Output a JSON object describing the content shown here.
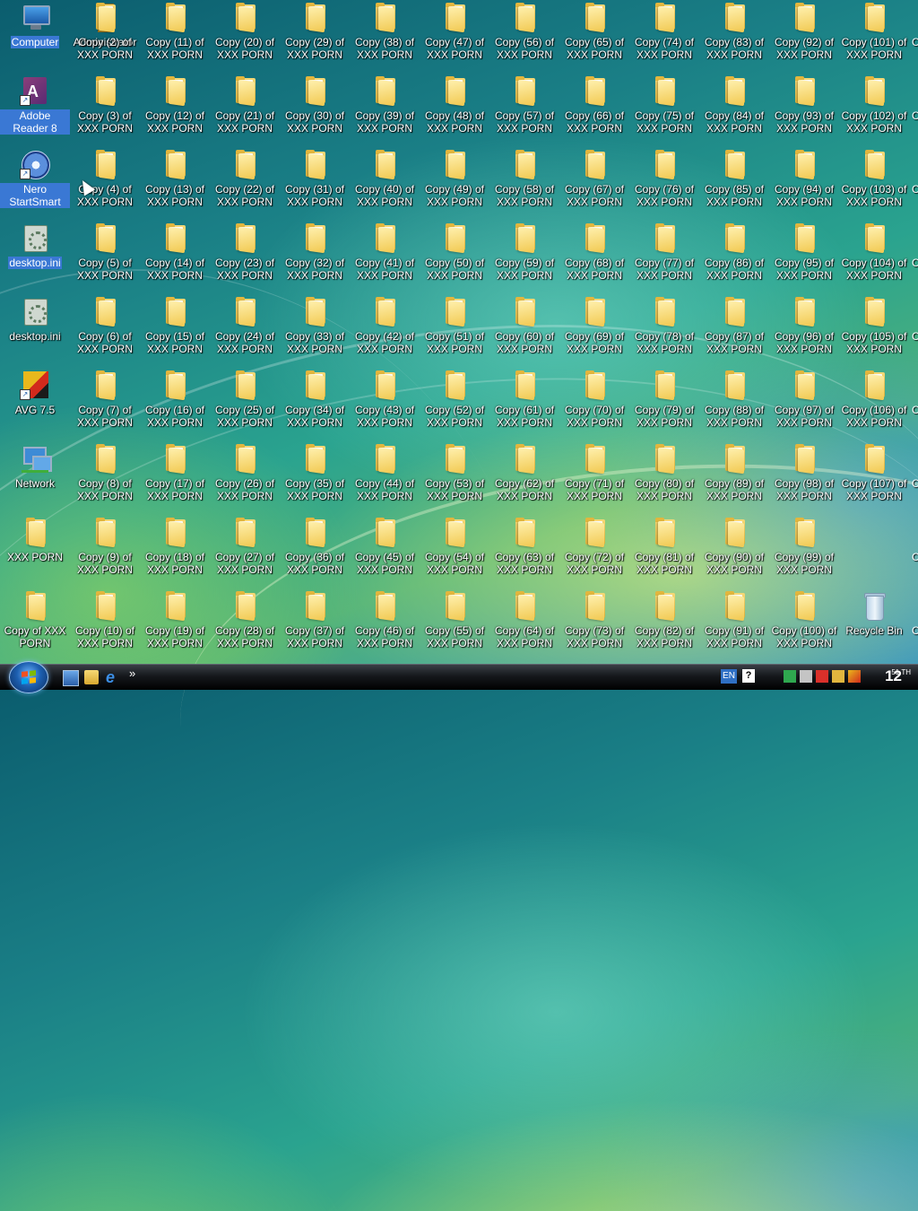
{
  "desktop": {
    "icons": [
      {
        "label": "Computer",
        "type": "computer",
        "selected": true
      },
      {
        "label": "Adobe Reader 8",
        "type": "pdf",
        "selected": true
      },
      {
        "label": "Nero StartSmart",
        "type": "nero",
        "selected": true
      },
      {
        "label": "desktop.ini",
        "type": "ini",
        "selected": true
      },
      {
        "label": "desktop.ini",
        "type": "ini",
        "selected": false
      },
      {
        "label": "AVG 7.5",
        "type": "avg",
        "selected": false
      },
      {
        "label": "Network",
        "type": "network",
        "selected": false
      },
      {
        "label": "XXX PORN",
        "type": "folder",
        "selected": false
      },
      {
        "label": "Copy of XXX PORN",
        "type": "folder",
        "selected": false
      },
      {
        "label": "Administrator",
        "type": "admin",
        "selected": false
      },
      {
        "label": "Recycle Bin",
        "type": "bin",
        "selected": false
      }
    ],
    "copy_folders": [
      "Copy (2) of XXX PORN",
      "Copy (3) of XXX PORN",
      "Copy (4) of XXX PORN",
      "Copy (5) of XXX PORN",
      "Copy (6) of XXX PORN",
      "Copy (7) of XXX PORN",
      "Copy (8) of XXX PORN",
      "Copy (9) of XXX PORN",
      "Copy (10) of XXX PORN",
      "Copy (11) of XXX PORN",
      "Copy (12) of XXX PORN",
      "Copy (13) of XXX PORN",
      "Copy (14) of XXX PORN",
      "Copy (15) of XXX PORN",
      "Copy (16) of XXX PORN",
      "Copy (17) of XXX PORN",
      "Copy (18) of XXX PORN",
      "Copy (19) of XXX PORN",
      "Copy (20) of XXX PORN",
      "Copy (21) of XXX PORN",
      "Copy (22) of XXX PORN",
      "Copy (23) of XXX PORN",
      "Copy (24) of XXX PORN",
      "Copy (25) of XXX PORN",
      "Copy (26) of XXX PORN",
      "Copy (27) of XXX PORN",
      "Copy (28) of XXX PORN",
      "Copy (29) of XXX PORN",
      "Copy (30) of XXX PORN",
      "Copy (31) of XXX PORN",
      "Copy (32) of XXX PORN",
      "Copy (33) of XXX PORN",
      "Copy (34) of XXX PORN",
      "Copy (35) of XXX PORN",
      "Copy (36) of XXX PORN",
      "Copy (37) of XXX PORN",
      "Copy (38) of XXX PORN",
      "Copy (39) of XXX PORN",
      "Copy (40) of XXX PORN",
      "Copy (41) of XXX PORN",
      "Copy (42) of XXX PORN",
      "Copy (43) of XXX PORN",
      "Copy (44) of XXX PORN",
      "Copy (45) of XXX PORN",
      "Copy (46) of XXX PORN",
      "Copy (47) of XXX PORN",
      "Copy (48) of XXX PORN",
      "Copy (49) of XXX PORN",
      "Copy (50) of XXX PORN",
      "Copy (51) of XXX PORN",
      "Copy (52) of XXX PORN",
      "Copy (53) of XXX PORN",
      "Copy (54) of XXX PORN",
      "Copy (55) of XXX PORN",
      "Copy (56) of XXX PORN",
      "Copy (57) of XXX PORN",
      "Copy (58) of XXX PORN",
      "Copy (59) of XXX PORN",
      "Copy (60) of XXX PORN",
      "Copy (61) of XXX PORN",
      "Copy (62) of XXX PORN",
      "Copy (63) of XXX PORN",
      "Copy (64) of XXX PORN",
      "Copy (65) of XXX PORN",
      "Copy (66) of XXX PORN",
      "Copy (67) of XXX PORN",
      "Copy (68) of XXX PORN",
      "Copy (69) of XXX PORN",
      "Copy (70) of XXX PORN",
      "Copy (71) of XXX PORN",
      "Copy (72) of XXX PORN",
      "Copy (73) of XXX PORN",
      "Copy (74) of XXX PORN",
      "Copy (75) of XXX PORN",
      "Copy (76) of XXX PORN",
      "Copy (77) of XXX PORN",
      "Copy (78) of XXX PORN",
      "Copy (79) of XXX PORN",
      "Copy (80) of XXX PORN",
      "Copy (81) of XXX PORN",
      "Copy (82) of XXX PORN",
      "Copy (83) of XXX PORN",
      "Copy (84) of XXX PORN",
      "Copy (85) of XXX PORN",
      "Copy (86) of XXX PORN",
      "Copy (87) of XXX PORN",
      "Copy (88) of XXX PORN",
      "Copy (89) of XXX PORN",
      "Copy (90) of XXX PORN",
      "Copy (91) of XXX PORN",
      "Copy (92) of XXX PORN",
      "Copy (93) of XXX PORN",
      "Copy (94) of XXX PORN",
      "Copy (95) of XXX PORN",
      "Copy (96) of XXX PORN",
      "Copy (97) of XXX PORN",
      "Copy (98) of XXX PORN",
      "Copy (99) of XXX PORN",
      "Copy (100) of XXX PORN",
      "Copy (101) of XXX PORN",
      "Copy (102) of XXX PORN",
      "Copy (103) of XXX PORN",
      "Copy (104) of XXX PORN",
      "Copy (105) of XXX PORN",
      "Copy (106) of XXX PORN",
      "Copy (107) of XXX PORN"
    ],
    "partial_column_label": "C"
  },
  "taskbar": {
    "quick_launch": [
      "show-desktop",
      "windows-explorer",
      "internet-explorer"
    ],
    "quick_launch_more": "»",
    "language": "EN",
    "help": "?",
    "clock": "12",
    "clock_suffix": "51 TH"
  },
  "colors": {
    "selection": "#3a78d4",
    "taskbar": "#15181c",
    "folder": "#f1c84f"
  }
}
